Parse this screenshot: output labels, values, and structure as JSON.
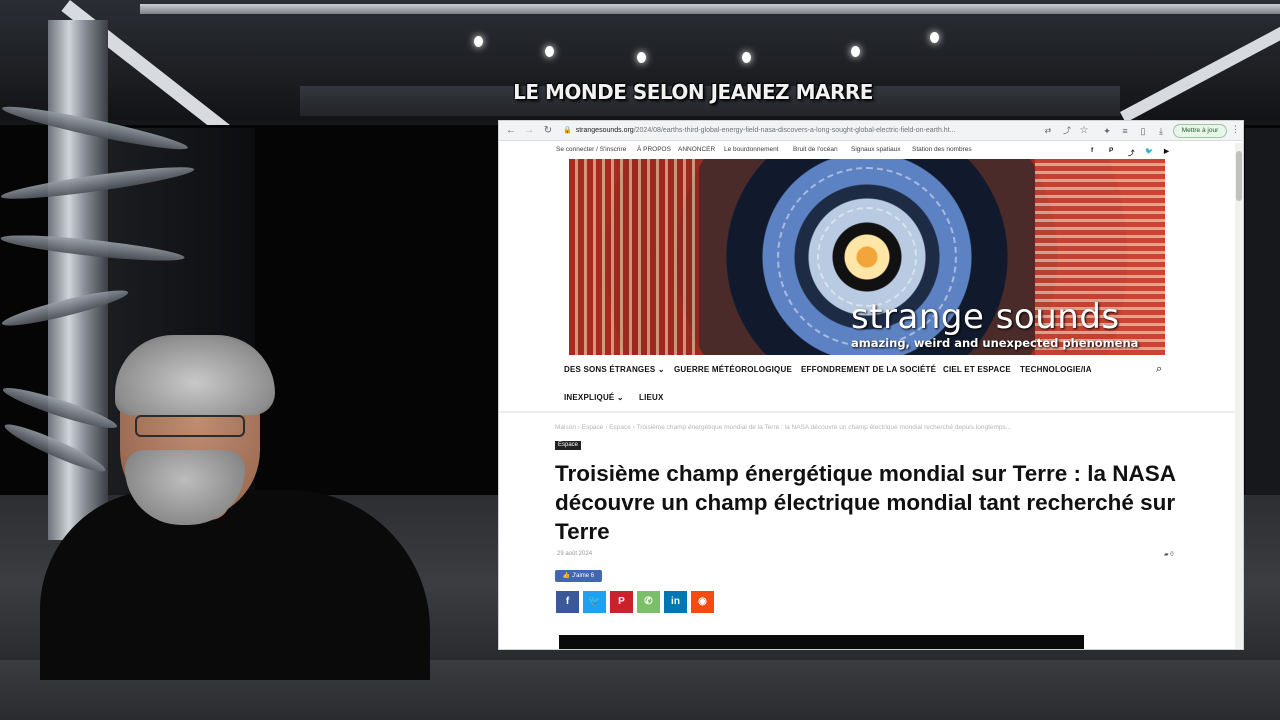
{
  "overlay": {
    "title": "LE MONDE SELON JEANEZ MARRE"
  },
  "browser": {
    "url": {
      "domain": "strangesounds.org",
      "path": "/2024/08/earths-third-global-energy-field-nasa-discovers-a-long-sought-global-electric-field-on-earth.ht..."
    },
    "update_label": "Mettre à jour",
    "icons": {
      "back": "arrow-left-icon",
      "forward": "arrow-right-icon",
      "reload": "reload-icon",
      "lock": "lock-icon",
      "translate": "translate-icon",
      "share": "share-icon",
      "bookmark": "star-icon",
      "extensions": "puzzle-icon",
      "tab_search": "list-icon",
      "sidebar": "sidebar-icon",
      "downloads": "download-icon",
      "menu": "menu-dots-icon"
    }
  },
  "site": {
    "topbar": [
      "Se connecter / S'inscrire",
      "À PROPOS",
      "ANNONCER",
      "Le bourdonnement",
      "Bruit de l'océan",
      "Signaux spatiaux",
      "Station des nombres"
    ],
    "social": [
      "f",
      "P",
      "⤴",
      "🐦",
      "▶"
    ],
    "banner": {
      "brand": "strange sounds",
      "tagline": "amazing, weird and unexpected phenomena"
    },
    "nav": [
      "DES SONS ÉTRANGES",
      "GUERRE MÉTÉOROLOGIQUE",
      "EFFONDREMENT DE LA SOCIÉTÉ",
      "CIEL ET ESPACE",
      "TECHNOLOGIE/IA",
      "INEXPLIQUÉ",
      "LIEUX"
    ],
    "nav_dropdown_marker": "⌄"
  },
  "article": {
    "breadcrumb": "Maison  ›  Espace  ›  Espace  ›  Troisième champ énergétique mondial de la Terre : la NASA découvre un champ électrique mondial recherché depuis longtemps...",
    "category": "Espace",
    "title": "Troisième champ énergétique mondial sur Terre : la NASA découvre un champ électrique mondial tant recherché sur Terre",
    "date": "29 août 2024",
    "comments": "0",
    "fb_like": "👍 J'aime 6",
    "share_buttons": [
      {
        "icon": "facebook-icon",
        "glyph": "f",
        "color": "#3b5998"
      },
      {
        "icon": "twitter-icon",
        "glyph": "🐦",
        "color": "#1da1f2"
      },
      {
        "icon": "pinterest-icon",
        "glyph": "P",
        "color": "#ca212a"
      },
      {
        "icon": "whatsapp-icon",
        "glyph": "✆",
        "color": "#7bbf6a"
      },
      {
        "icon": "linkedin-icon",
        "glyph": "in",
        "color": "#0077b5"
      },
      {
        "icon": "reddit-icon",
        "glyph": "◉",
        "color": "#f54b11"
      }
    ]
  }
}
